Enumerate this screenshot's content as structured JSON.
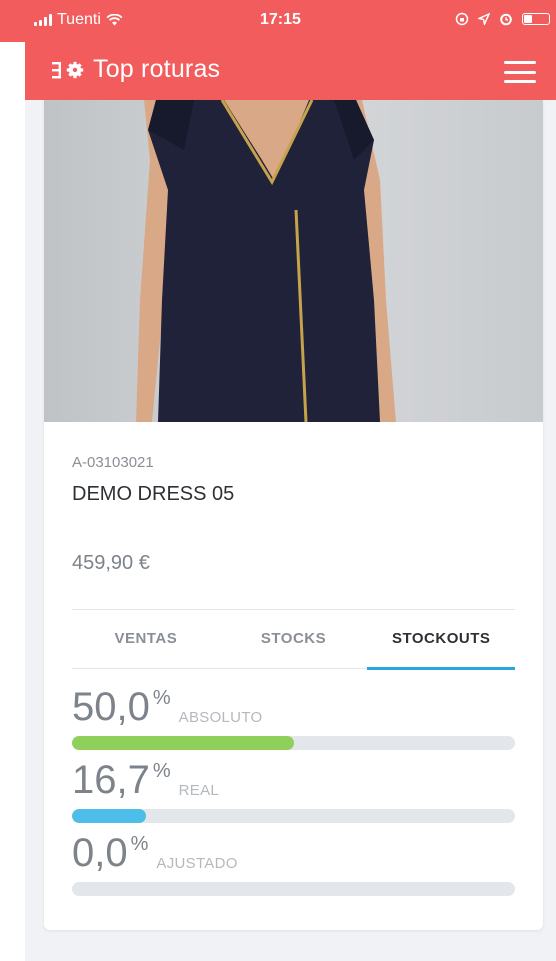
{
  "status_bar": {
    "carrier": "Tuenti",
    "time": "17:15"
  },
  "app_bar": {
    "title": "Top roturas",
    "color": "#f25c5c"
  },
  "product": {
    "sku": "A-03103021",
    "name": "DEMO DRESS 05",
    "price": "459,90 €"
  },
  "tabs": [
    {
      "label": "VENTAS",
      "active": false
    },
    {
      "label": "STOCKS",
      "active": false
    },
    {
      "label": "STOCKOUTS",
      "active": true
    }
  ],
  "metrics": [
    {
      "value": "50,0",
      "unit": "%",
      "label": "ABSOLUTO",
      "fraction": 0.5,
      "color": "#8fd05a"
    },
    {
      "value": "16,7",
      "unit": "%",
      "label": "REAL",
      "fraction": 0.167,
      "color": "#4dbde9"
    },
    {
      "value": "0,0",
      "unit": "%",
      "label": "AJUSTADO",
      "fraction": 0.0,
      "color": "#8fd05a"
    }
  ],
  "colors": {
    "accent_tab": "#2ba5e0"
  }
}
